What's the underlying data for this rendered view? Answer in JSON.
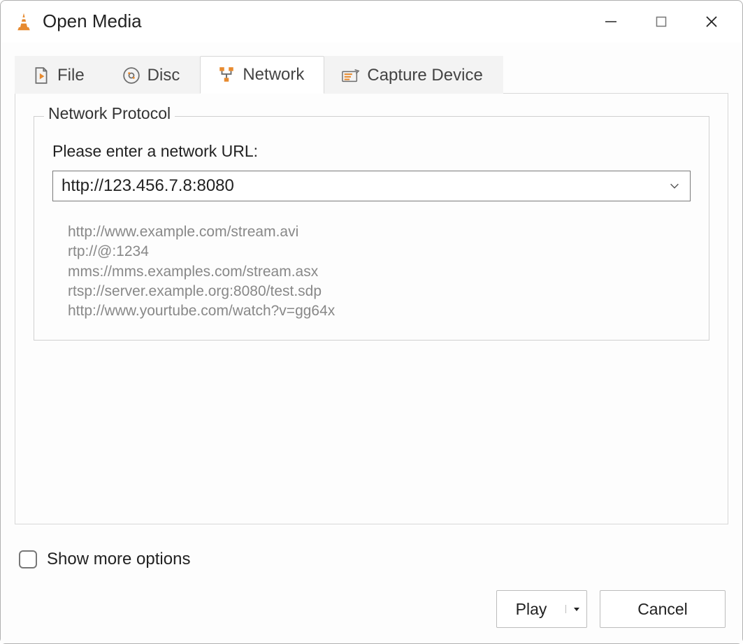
{
  "window": {
    "title": "Open Media"
  },
  "tabs": {
    "file": {
      "label": "File"
    },
    "disc": {
      "label": "Disc"
    },
    "network": {
      "label": "Network"
    },
    "capture": {
      "label": "Capture Device"
    },
    "active": "network"
  },
  "network_panel": {
    "group_title": "Network Protocol",
    "url_label": "Please enter a network URL:",
    "url_value": "http://123.456.7.8:8080",
    "examples": [
      "http://www.example.com/stream.avi",
      "rtp://@:1234",
      "mms://mms.examples.com/stream.asx",
      "rtsp://server.example.org:8080/test.sdp",
      "http://www.yourtube.com/watch?v=gg64x"
    ]
  },
  "footer": {
    "show_more_label": "Show more options",
    "show_more_checked": false,
    "play_label": "Play",
    "cancel_label": "Cancel"
  },
  "icons": {
    "app": "vlc-cone-icon",
    "file": "file-play-icon",
    "disc": "disc-icon",
    "network": "network-lan-icon",
    "capture": "capture-device-icon"
  },
  "colors": {
    "accent_orange": "#e78a2f",
    "icon_gray": "#6d6d6d"
  }
}
